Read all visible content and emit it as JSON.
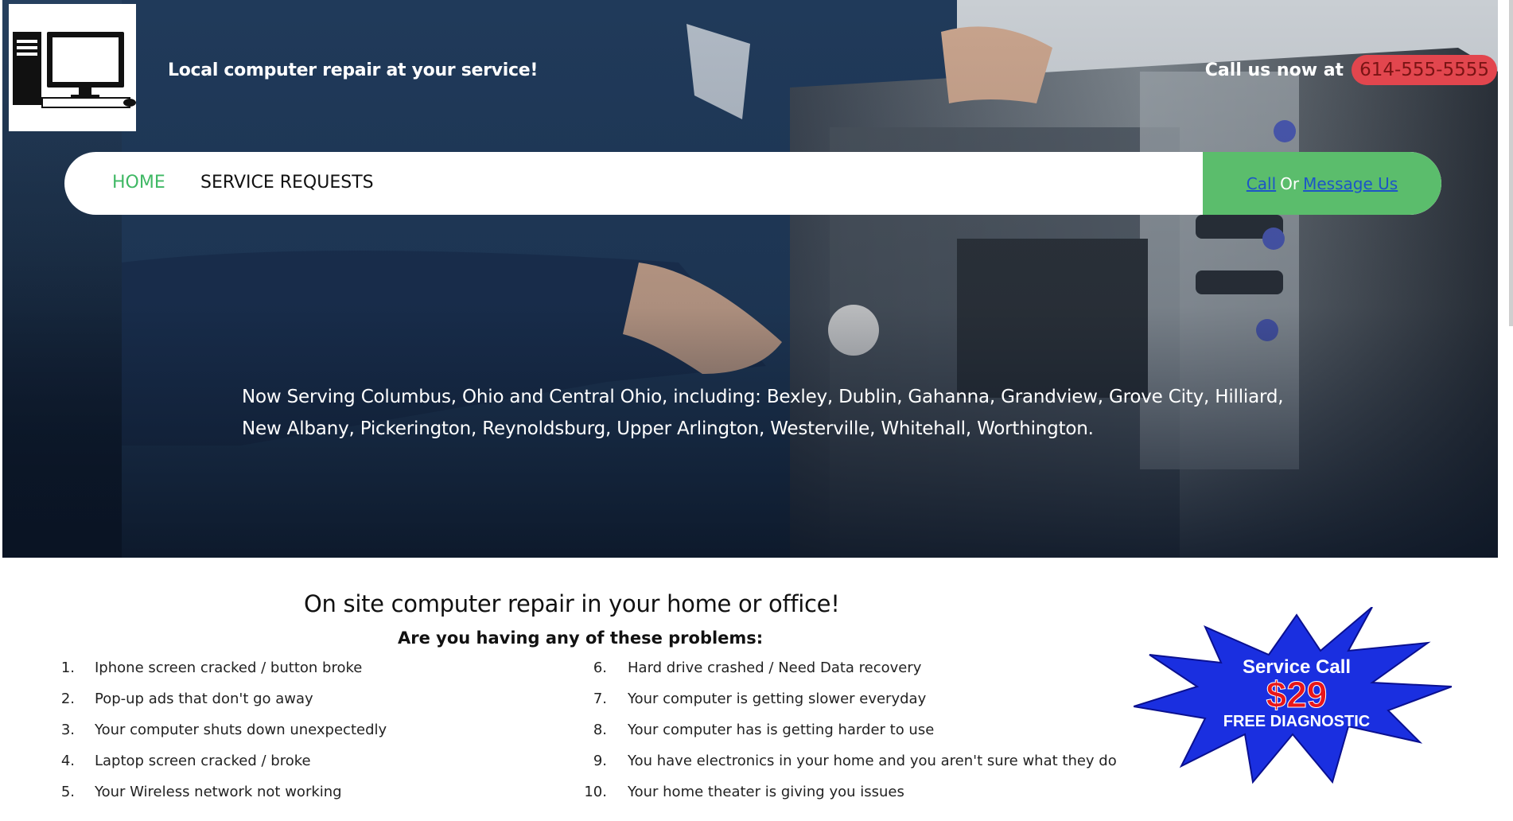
{
  "header": {
    "tagline": "Local computer repair at your service!",
    "call_label": "Call us now at",
    "phone": "614-555-5555"
  },
  "nav": {
    "home": "HOME",
    "service_requests": "SERVICE REQUESTS",
    "cta_call": "Call",
    "cta_or": "Or",
    "cta_message": "Message Us"
  },
  "hero": {
    "serving_text": "Now Serving Columbus, Ohio and Central Ohio, including: Bexley, Dublin, Gahanna, Grandview, Grove City, Hilliard, New Albany, Pickerington, Reynoldsburg, Upper Arlington, Westerville, Whitehall, Worthington."
  },
  "content": {
    "heading": "On site computer repair in your home or office!",
    "subheading": "Are you having any of these problems:",
    "problems_left": [
      {
        "num": "1.",
        "text": "Iphone screen cracked / button broke"
      },
      {
        "num": "2.",
        "text": "Pop-up ads that don't go away"
      },
      {
        "num": "3.",
        "text": "Your computer shuts down unexpectedly"
      },
      {
        "num": "4.",
        "text": "Laptop screen cracked / broke"
      },
      {
        "num": "5.",
        "text": "Your Wireless network not working"
      }
    ],
    "problems_right": [
      {
        "num": "6.",
        "text": "Hard drive crashed / Need Data recovery"
      },
      {
        "num": "7.",
        "text": "Your computer is getting slower everyday"
      },
      {
        "num": "8.",
        "text": "Your computer has is getting harder to use"
      },
      {
        "num": "9.",
        "text": "You have electronics in your home and you aren't sure what they do"
      },
      {
        "num": "10.",
        "text": "Your home theater is giving you issues"
      }
    ]
  },
  "promo": {
    "line1": "Service Call",
    "price": "$29",
    "line2": "FREE DIAGNOSTIC"
  },
  "colors": {
    "accent_green": "#5bbd6c",
    "home_green": "#3fb864",
    "phone_red": "#e2464e",
    "starburst_blue": "#1a2fe0",
    "price_red": "#e8161a"
  }
}
